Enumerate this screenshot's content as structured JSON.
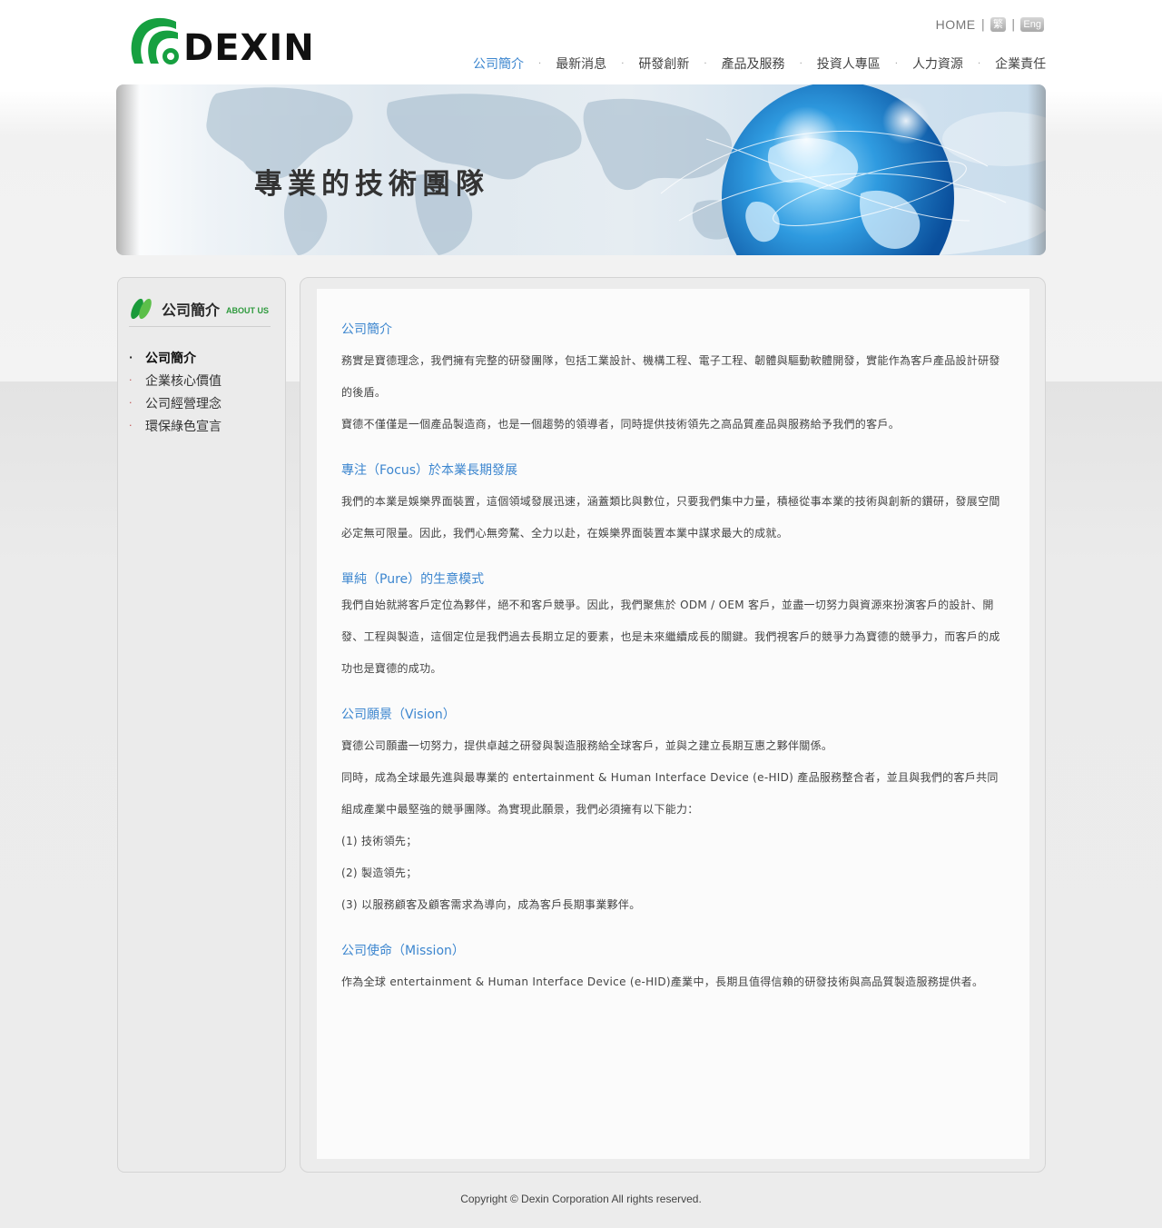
{
  "header": {
    "logo_text": "DEXIN",
    "home_label": "HOME",
    "lang_zh": "繁",
    "lang_en": "Eng",
    "separator": "|"
  },
  "nav": {
    "items": [
      {
        "label": "公司簡介",
        "active": true
      },
      {
        "label": "最新消息",
        "active": false
      },
      {
        "label": "研發創新",
        "active": false
      },
      {
        "label": "產品及服務",
        "active": false
      },
      {
        "label": "投資人專區",
        "active": false
      },
      {
        "label": "人力資源",
        "active": false
      },
      {
        "label": "企業責任",
        "active": false
      }
    ],
    "separator": "·"
  },
  "banner": {
    "title": "專業的技術團隊"
  },
  "sidebar": {
    "title": "公司簡介",
    "subtitle": "ABOUT US",
    "items": [
      {
        "label": "公司簡介",
        "active": true
      },
      {
        "label": "企業核心價值",
        "active": false
      },
      {
        "label": "公司經營理念",
        "active": false
      },
      {
        "label": "環保綠色宣言",
        "active": false
      }
    ]
  },
  "content": {
    "s1_title": "公司簡介",
    "s1_p1": "務實是寶德理念，我們擁有完整的研發團隊，包括工業設計、機構工程、電子工程、韌體與驅動軟體開發，實能作為客戶產品設計研發的後盾。",
    "s1_p2": "寶德不僅僅是一個產品製造商，也是一個趨勢的領導者，同時提供技術領先之高品質產品與服務給予我們的客戶。",
    "s2_title": "專注（Focus）於本業長期發展",
    "s2_p1": "我們的本業是娛樂界面裝置，這個領域發展迅速，涵蓋類比與數位，只要我們集中力量，積極從事本業的技術與創新的鑽研，發展空間必定無可限量。因此，我們心無旁騖、全力以赴，在娛樂界面裝置本業中謀求最大的成就。",
    "s3_title": "單純（Pure）的生意模式",
    "s3_p1": "我們自始就將客戶定位為夥伴，絕不和客戶競爭。因此，我們聚焦於 ODM / OEM 客戶，並盡一切努力與資源來扮演客戶的設計、開發、工程與製造，這個定位是我們過去長期立足的要素，也是未來繼續成長的關鍵。我們視客戶的競爭力為寶德的競爭力，而客戶的成功也是寶德的成功。",
    "s4_title": "公司願景（Vision）",
    "s4_p1": "寶德公司願盡一切努力，提供卓越之研發與製造服務給全球客戶，並與之建立長期互惠之夥伴關係。",
    "s4_p2": "同時，成為全球最先進與最專業的 entertainment & Human Interface Device (e-HID) 產品服務整合者，並且與我們的客戶共同組成產業中最堅強的競爭團隊。為實現此願景，我們必須擁有以下能力：",
    "s4_p3": "(1) 技術領先；",
    "s4_p4": "(2) 製造領先；",
    "s4_p5": "(3) 以服務顧客及顧客需求為導向，成為客戶長期事業夥伴。",
    "s5_title": "公司使命（Mission）",
    "s5_p1": "作為全球 entertainment & Human Interface Device (e-HID)產業中，長期且值得信賴的研發技術與高品質製造服務提供者。"
  },
  "footer": {
    "copyright": "Copyright © Dexin Corporation All rights reserved."
  },
  "colors": {
    "brand_green": "#16a040",
    "link_blue": "#3c86cf"
  }
}
